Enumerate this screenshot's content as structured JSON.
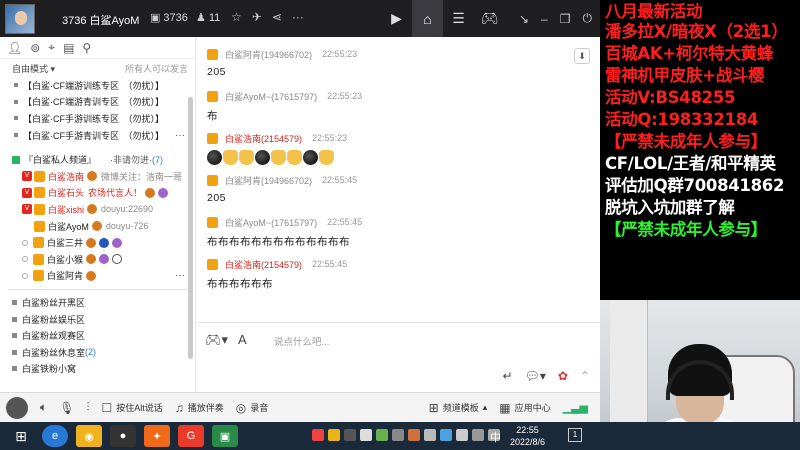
{
  "topbar": {
    "channel_id": "3736 白鲨AyoM",
    "stat_id": "3736",
    "stat_users": "11"
  },
  "sidebar": {
    "mode_label": "自由模式",
    "mode_hint": "所有人可以发言",
    "channels_top": [
      {
        "label": "【白鲨·CF端游训练专区　（勿扰）】"
      },
      {
        "label": "【白鲨·CF端游青训专区　（勿扰）】"
      },
      {
        "label": "【白鲨·CF手游训练专区　（勿扰）】"
      },
      {
        "label": "【白鲨·CF手游青训专区　（勿扰）】"
      }
    ],
    "private": {
      "label": "『白鲨私人频道』",
      "hint": "·非请勿进·",
      "count": "(7)"
    },
    "members": [
      {
        "name": "白鲨浩南",
        "note": "微博关注：浩南一哥",
        "red": true
      },
      {
        "name": "白鲨石头",
        "note": "农场代言人！",
        "red": true
      },
      {
        "name": "白鲨xishi",
        "note": "douyu:22690",
        "red": true
      },
      {
        "name": "白鲨AyoM",
        "note": "douyu-726",
        "red": false
      },
      {
        "name": "白鲨三井",
        "note": "",
        "red": false
      },
      {
        "name": "白鲨小猴",
        "note": "",
        "red": false
      },
      {
        "name": "白鲨阿肯",
        "note": "",
        "red": false
      }
    ],
    "fan_groups": [
      {
        "label": "白鲨粉丝开黑区",
        "count": ""
      },
      {
        "label": "白鲨粉丝娱乐区",
        "count": ""
      },
      {
        "label": "白鲨粉丝观赛区",
        "count": ""
      },
      {
        "label": "白鲨粉丝休息室",
        "count": "(2)"
      },
      {
        "label": "白鲨铁粉小窝",
        "count": ""
      }
    ]
  },
  "chat": {
    "messages": [
      {
        "name": "白鲨阿肯(194966702)",
        "time": "22:55:23",
        "text": "205",
        "red": false
      },
      {
        "name": "白鲨AyoM~(17615797)",
        "time": "22:55:23",
        "text": "布",
        "red": false
      },
      {
        "name": "白鲨浩南(2154579)",
        "time": "22:55:23",
        "text": "",
        "red": true
      },
      {
        "name": "白鲨阿肯(194966702)",
        "time": "22:55:45",
        "text": "205",
        "red": false
      },
      {
        "name": "白鲨AyoM~(17615797)",
        "time": "22:55:45",
        "text": "布布布布布布布布布布布布布",
        "red": false
      },
      {
        "name": "白鲨浩南(2154579)",
        "time": "22:55:45",
        "text": "布布布布布布",
        "red": true
      }
    ],
    "emoji_sequence": [
      "bomb-emoji",
      "hand-emoji",
      "hand-emoji",
      "bomb-emoji",
      "hand-emoji",
      "hand-emoji",
      "bomb-emoji",
      "hand-emoji"
    ]
  },
  "input": {
    "placeholder": "说点什么吧..."
  },
  "bottombar": {
    "press_alt": "按住Alt说话",
    "music": "播放伴奏",
    "record": "录音",
    "template": "频道模板",
    "app_center": "应用中心"
  },
  "taskbar": {
    "time": "22:55",
    "date": "2022/8/6",
    "ime": "中",
    "notifications": "1"
  },
  "overlay": {
    "lines": [
      {
        "text": "八月最新活动",
        "color": "red"
      },
      {
        "text": "潘多拉X/暗夜X（2选1）",
        "color": "red"
      },
      {
        "text": "百城AK+柯尔特大黄蜂",
        "color": "red"
      },
      {
        "text": "雷神机甲皮肤+战斗樱",
        "color": "red"
      },
      {
        "text": "活动V:BS48255",
        "color": "red"
      },
      {
        "text": "活动Q:198332184",
        "color": "red"
      },
      {
        "text": "【严禁未成年人参与】",
        "color": "red"
      },
      {
        "text": "CF/LOL/王者/和平精英",
        "color": "white"
      },
      {
        "text": "评估加Q群700841862",
        "color": "white"
      },
      {
        "text": "脱坑入坑加群了解",
        "color": "white"
      },
      {
        "text": "【严禁未成年人参与】",
        "color": "green"
      }
    ]
  },
  "colors": {
    "topbar_bg": "#1f1f22",
    "name_red": "#d8201a",
    "overlay_red": "#ff1d1d",
    "overlay_green": "#2df22d"
  }
}
